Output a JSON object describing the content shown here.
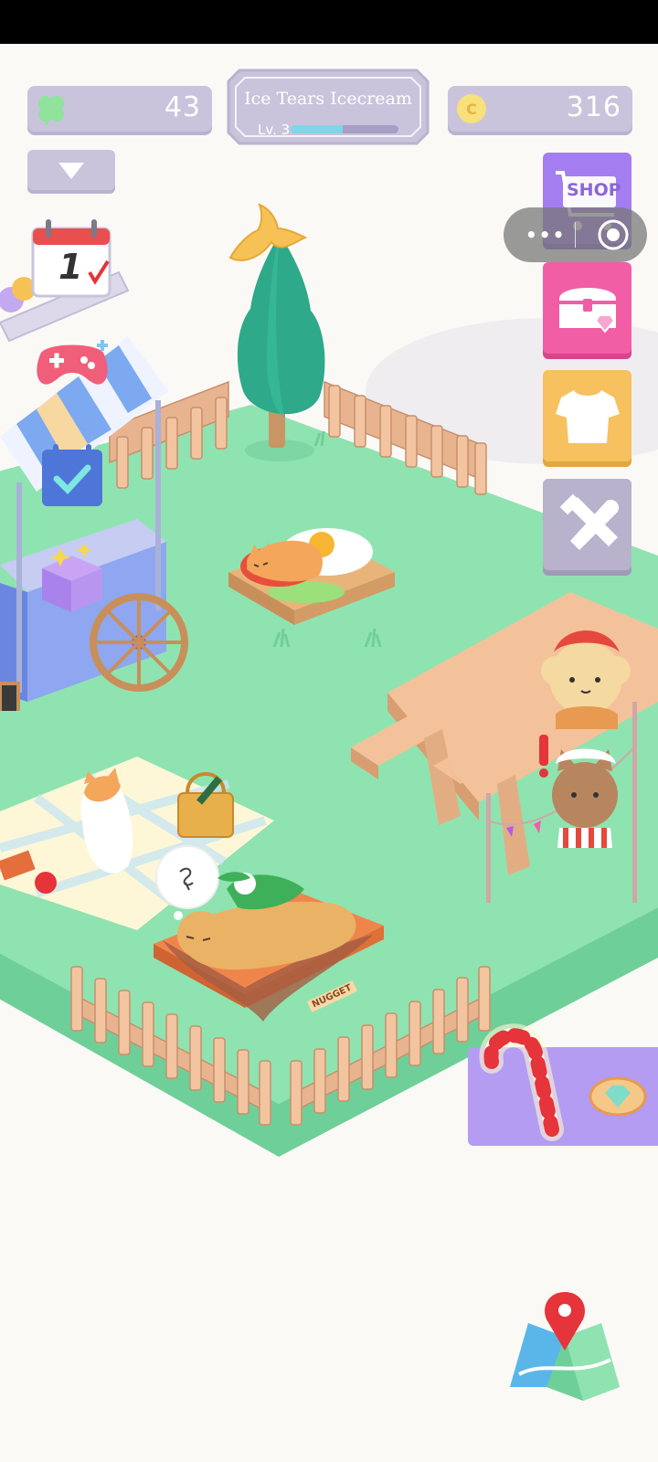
{
  "hud": {
    "clover_count": "43",
    "coin_count": "316",
    "shop_label": "SHOP",
    "level": {
      "name": "Ice Tears Icecream",
      "label": "Lv. 3",
      "progress": 0.48
    }
  },
  "scene": {
    "dog_bed_label": "NUGGET",
    "calendar_day": "1"
  },
  "icons": [
    "clover-icon",
    "coin-icon",
    "dropdown-arrow-icon",
    "shop-cart-icon",
    "treasure-chest-icon",
    "shirt-icon",
    "tools-icon",
    "calendar-icon",
    "gamepad-icon",
    "checklist-icon",
    "gift-box-icon",
    "map-icon",
    "gem-icon",
    "candy-cane-icon",
    "banana-peel-icon"
  ],
  "colors": {
    "grass": "#8fe3b0",
    "hud_pill": "#c9c4dc",
    "shop_button": "#a47ef0",
    "chest_button": "#f15ea6",
    "shirt_button": "#f6c15e",
    "tools_button": "#b8b2cc",
    "candy_panel": "#b39cf2"
  }
}
